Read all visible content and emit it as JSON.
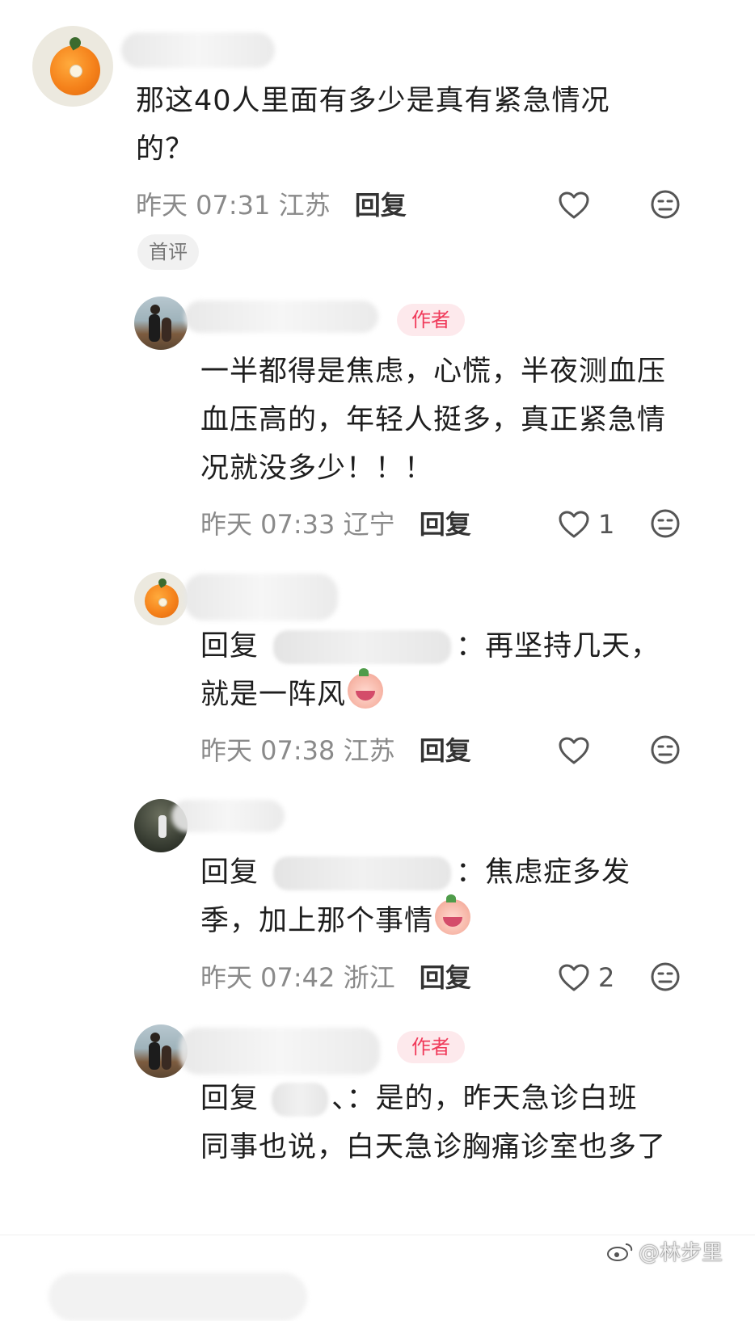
{
  "comments": [
    {
      "text": "那这40人里面有多少是真有紧急情况的？",
      "time": "昨天 07:31",
      "location": "江苏",
      "reply_label": "回复",
      "likes": "",
      "tag": "首评"
    },
    {
      "is_author": true,
      "author_badge": "作者",
      "text": "一半都得是焦虑，心慌，半夜测血压血压高的，年轻人挺多，真正紧急情况就没多少！！！",
      "time": "昨天 07:33",
      "location": "辽宁",
      "reply_label": "回复",
      "likes": "1"
    },
    {
      "reply_prefix": "回复",
      "reply_text": "：再坚持几天，",
      "text_line2": "就是一阵风",
      "time": "昨天 07:38",
      "location": "江苏",
      "reply_label": "回复",
      "likes": ""
    },
    {
      "reply_prefix": "回复",
      "reply_text": "：焦虑症多发",
      "text_line2": "季，加上那个事情",
      "time": "昨天 07:42",
      "location": "浙江",
      "reply_label": "回复",
      "likes": "2"
    },
    {
      "is_author": true,
      "author_badge": "作者",
      "reply_prefix": "回复",
      "reply_target_visible": "、",
      "reply_text": "：是的，昨天急诊白班",
      "text_rest": "同事也说，白天急诊胸痛诊室也多了"
    }
  ],
  "watermark": "@林步里",
  "icons": {
    "like": "heart-outline-icon",
    "dislike": "meh-face-icon",
    "weibo": "weibo-logo-icon"
  },
  "colors": {
    "author_badge_bg": "#fde9ec",
    "author_badge_text": "#f03a5a",
    "meta_text": "#8a8a8a"
  }
}
